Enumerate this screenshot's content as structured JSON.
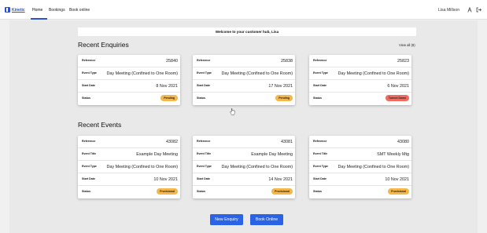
{
  "nav": {
    "logo": "Kinetic",
    "items": [
      "Home",
      "Bookings",
      "Book online"
    ],
    "user_name": "Lisa Millson"
  },
  "welcome": "Welcome to your customer hub, Lisa",
  "enquiries": {
    "title": "Recent Enquiries",
    "view_all": "View all (8)",
    "labels": [
      "Reference",
      "Event Type",
      "Start Date",
      "Status"
    ],
    "cards": [
      {
        "reference": "25840",
        "event_type": "Day Meeting (Confined to One Room)",
        "start_date": "8 Nov 2021",
        "status": "Pending",
        "status_color": "#f5b74a"
      },
      {
        "reference": "25838",
        "event_type": "Day Meeting (Confined to One Room)",
        "start_date": "17 Nov 2021",
        "status": "Pending",
        "status_color": "#f5b74a"
      },
      {
        "reference": "25823",
        "event_type": "Day Meeting (Confined to One Room)",
        "start_date": "6 Nov 2021",
        "status": "Turned Down",
        "status_color": "#ef6b5e"
      }
    ]
  },
  "events": {
    "title": "Recent Events",
    "labels": [
      "Reference",
      "Event Title",
      "Event Type",
      "Start Date",
      "Status"
    ],
    "cards": [
      {
        "reference": "43082",
        "event_title": "Example Day Meeting",
        "event_type": "Day Meeting (Confined to One Room)",
        "start_date": "10 Nov 2021",
        "status": "Provisional",
        "status_color": "#f5b74a"
      },
      {
        "reference": "43081",
        "event_title": "Example Day Meeting",
        "event_type": "Day Meeting (Confined to One Room)",
        "start_date": "14 Nov 2021",
        "status": "Provisional",
        "status_color": "#f5b74a"
      },
      {
        "reference": "43080",
        "event_title": "SMT Weekly Mtg",
        "event_type": "Day Meeting (Confined to One Room)",
        "start_date": "10 Nov 2021",
        "status": "Provisional",
        "status_color": "#f5b74a"
      }
    ]
  },
  "buttons": {
    "new_enquiry": "New Enquiry",
    "book_online": "Book Online"
  },
  "icons": {
    "logo": "kinetic-logo-icon",
    "user": "person-icon",
    "logout": "logout-icon",
    "cursor": "hand-pointer-icon"
  },
  "colors": {
    "accent": "#2a63e6",
    "pending": "#f5b74a",
    "turned_down": "#ef6b5e"
  }
}
